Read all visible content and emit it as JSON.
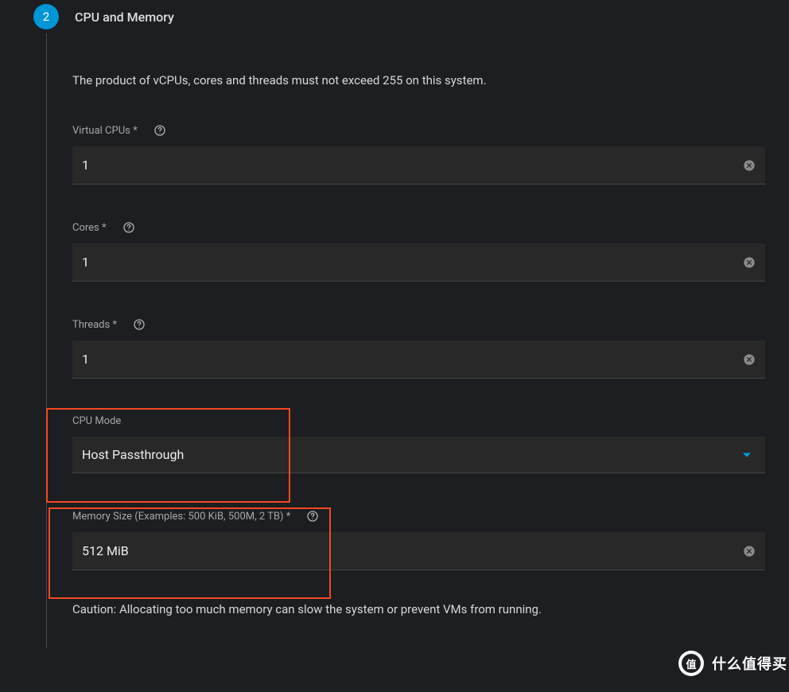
{
  "step": {
    "number": "2",
    "title": "CPU and Memory"
  },
  "info": "The product of vCPUs, cores and threads must not exceed 255 on this system.",
  "fields": {
    "vcpus": {
      "label": "Virtual CPUs *",
      "value": "1"
    },
    "cores": {
      "label": "Cores *",
      "value": "1"
    },
    "threads": {
      "label": "Threads *",
      "value": "1"
    },
    "cpu_mode": {
      "label": "CPU Mode",
      "value": "Host Passthrough"
    },
    "memory": {
      "label": "Memory Size (Examples: 500 KiB, 500M, 2 TB) *",
      "value": "512 MiB"
    }
  },
  "caution": "Caution: Allocating too much memory can slow the system or prevent VMs from running.",
  "watermark": {
    "badge": "值",
    "text": "什么值得买"
  }
}
